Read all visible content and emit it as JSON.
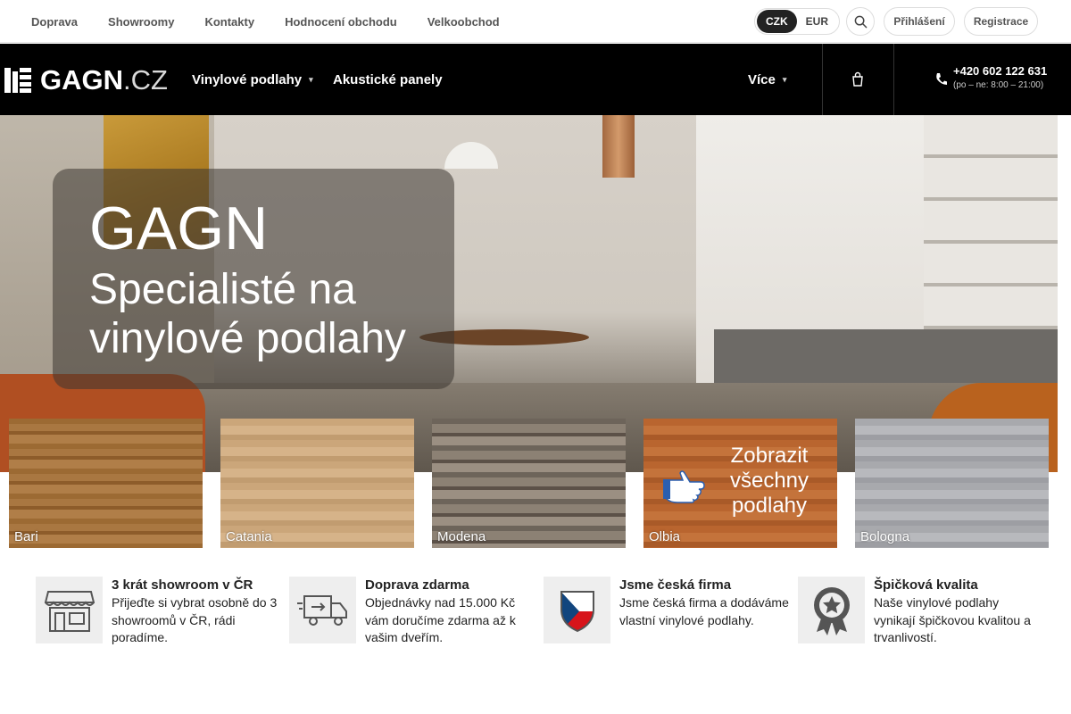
{
  "topbar": {
    "links": [
      "Doprava",
      "Showroomy",
      "Kontakty",
      "Hodnocení obchodu",
      "Velkoobchod"
    ],
    "currency": {
      "options": [
        "CZK",
        "EUR"
      ],
      "selected": "CZK"
    },
    "search_icon": "search-icon",
    "login_label": "Přihlášení",
    "register_label": "Registrace"
  },
  "nav": {
    "logo_text": "GAGN",
    "logo_tld": ".CZ",
    "items": [
      {
        "label": "Vinylové podlahy",
        "has_dropdown": true
      },
      {
        "label": "Akustické panely",
        "has_dropdown": false
      }
    ],
    "more_label": "Více",
    "cart_icon": "cart-icon",
    "phone_icon": "phone-icon",
    "phone": "+420 602 122 631",
    "hours": "(po – ne: 8:00 – 21:00)"
  },
  "hero": {
    "title": "GAGN",
    "subtitle": "Specialisté na vinylové podlahy"
  },
  "tiles": [
    {
      "label": "Bari"
    },
    {
      "label": "Catania"
    },
    {
      "label": "Modena"
    },
    {
      "label": "Olbia",
      "cta": "Zobrazit všechny podlahy"
    },
    {
      "label": "Bologna"
    }
  ],
  "features": [
    {
      "icon": "storefront-icon",
      "title": "3 krát showroom v ČR",
      "text": "Přijeďte si vybrat osobně do 3 showroomů v ČR, rádi poradíme."
    },
    {
      "icon": "delivery-truck-icon",
      "title": "Doprava zdarma",
      "text": "Objednávky nad 15.000 Kč vám doručíme zdarma až k vašim dveřím."
    },
    {
      "icon": "czech-flag-shield-icon",
      "title": "Jsme česká firma",
      "text": "Jsme česká firma a dodáváme vlastní vinylové podlahy."
    },
    {
      "icon": "quality-badge-icon",
      "title": "Špičková kvalita",
      "text": "Naše vinylové podlahy vynikají špičkovou kvalitou a trvanlivostí."
    }
  ],
  "colors": {
    "nav_bg": "#000000",
    "accent_dark": "#222222",
    "cta_orange": "#b9652f"
  }
}
